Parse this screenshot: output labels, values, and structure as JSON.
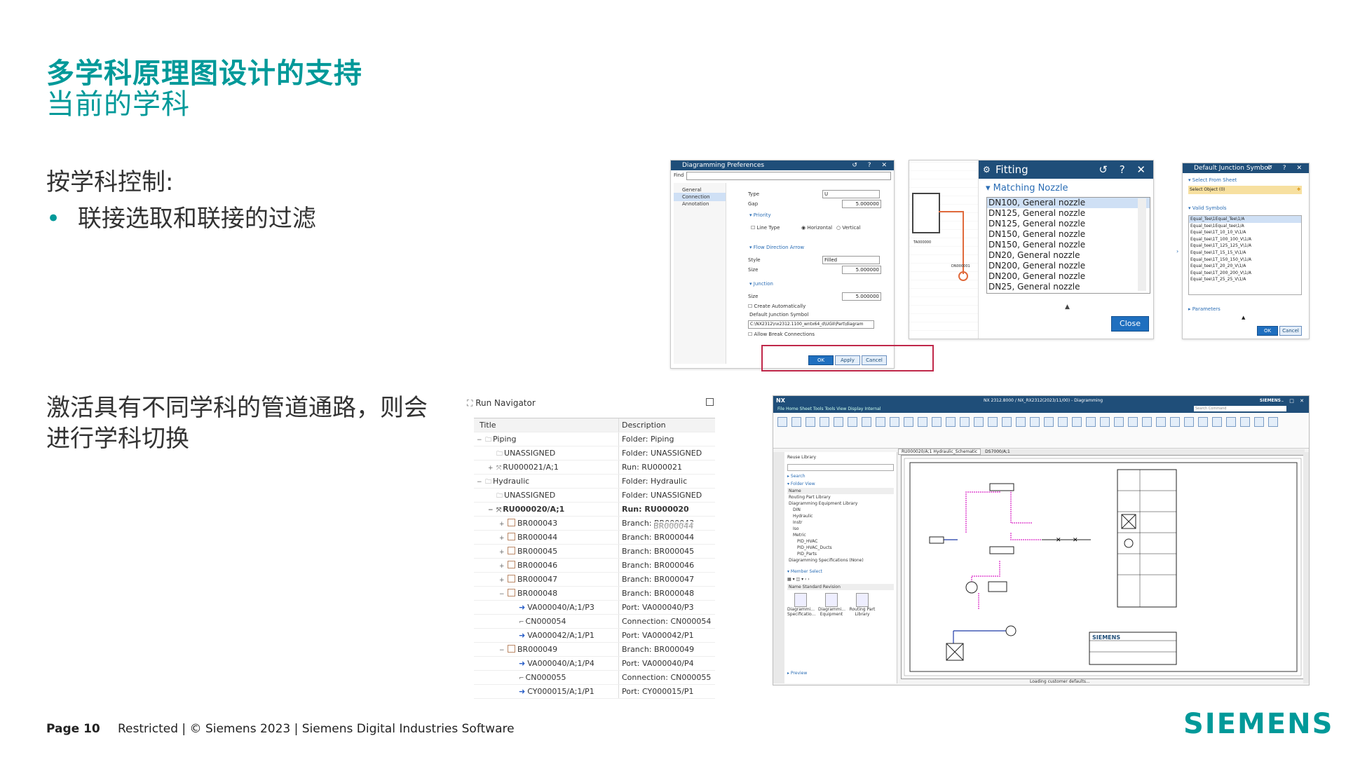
{
  "slide": {
    "title": "多学科原理图设计的支持",
    "subtitle": "当前的学科",
    "heading1": "按学科控制:",
    "bullet1": "联接选取和联接的过滤",
    "paragraph2_line1": "激活具有不同学科的管道通路，则会",
    "paragraph2_line2": "进行学科切换",
    "footer_page": "Page 10",
    "footer_text": "Restricted | © Siemens 2023 | Siemens Digital Industries Software",
    "logo": "SIEMENS",
    "accent_color": "#009999",
    "highlight_color": "#c0284a"
  },
  "prefs_dialog": {
    "title": "Diagramming Preferences",
    "find_label": "Find",
    "left_items": [
      "General",
      "Connection",
      "Annotation"
    ],
    "type_label": "Type",
    "type_value": "U",
    "gap_label": "Gap",
    "gap_value": "5.000000",
    "priority_section": "Priority",
    "line_type": "Line Type",
    "horizontal": "Horizontal",
    "vertical": "Vertical",
    "flow_section": "Flow Direction Arrow",
    "style_label": "Style",
    "style_value": "Filled",
    "size_label": "Size",
    "size_value": "5.000000",
    "junction_section": "Junction",
    "junction_size_label": "Size",
    "junction_size_value": "5.000000",
    "create_auto": "Create Automatically",
    "default_junction": "Default Junction Symbol",
    "junction_path": "C:\\NX2312\\nx2312.1100_wntx64_d\\UGII\\Part\\diagram",
    "allow_break": "Allow Break Connections",
    "ok": "OK",
    "apply": "Apply",
    "cancel": "Cancel"
  },
  "fitting_dialog": {
    "title": "Fitting",
    "section": "Matching Nozzle",
    "items": [
      "DN100, General nozzle",
      "DN125, General nozzle",
      "DN125, General nozzle",
      "DN150, General nozzle",
      "DN150, General nozzle",
      "DN20, General nozzle",
      "DN200, General nozzle",
      "DN200, General nozzle",
      "DN25, General nozzle"
    ],
    "close": "Close",
    "tag1": "TA000000",
    "tag2": "DN000001"
  },
  "junction_dialog": {
    "title": "Default Junction Symbol",
    "select_section": "Select From Sheet",
    "select_object": "Select Object (0)",
    "valid_section": "Valid Symbols",
    "symbols": [
      "Equal_Tee\\1Equal_Tee\\1/A",
      "Equal_tee\\1Equal_tee\\1/A",
      "Equal_tee\\1T_10_10_V\\1/A",
      "Equal_tee\\1T_100_100_V\\1/A",
      "Equal_tee\\1T_125_125_V\\1/A",
      "Equal_tee\\1T_15_15_V\\1/A",
      "Equal_tee\\1T_150_150_V\\1/A",
      "Equal_tee\\1T_20_20_V\\1/A",
      "Equal_tee\\1T_200_200_V\\1/A",
      "Equal_tee\\1T_25_25_V\\1/A"
    ],
    "parameters": "Parameters",
    "ok": "OK",
    "cancel": "Cancel"
  },
  "run_navigator": {
    "title": "Run Navigator",
    "col_title": "Title",
    "col_desc": "Description",
    "rows": [
      {
        "title": "Piping",
        "desc": "Folder: Piping",
        "indent": 0,
        "icon": "folder",
        "toggle": "-"
      },
      {
        "title": "UNASSIGNED",
        "desc": "Folder: UNASSIGNED",
        "indent": 1,
        "icon": "folder",
        "toggle": ""
      },
      {
        "title": "RU000021/A;1",
        "desc": "Run: RU000021",
        "indent": 1,
        "icon": "run",
        "toggle": "+"
      },
      {
        "title": "Hydraulic",
        "desc": "Folder: Hydraulic",
        "indent": 0,
        "icon": "folder",
        "toggle": "-"
      },
      {
        "title": "UNASSIGNED",
        "desc": "Folder: UNASSIGNED",
        "indent": 1,
        "icon": "folder",
        "toggle": ""
      },
      {
        "title": "RU000020/A;1",
        "desc": "Run: RU000020",
        "indent": 1,
        "icon": "run",
        "toggle": "-",
        "bold": true
      },
      {
        "title": "BR000043",
        "desc": "Branch: BR000043",
        "indent": 2,
        "icon": "branch",
        "toggle": "+"
      },
      {
        "title": "BR000044",
        "desc": "Branch: BR000044",
        "indent": 2,
        "icon": "branch",
        "toggle": "+"
      },
      {
        "title": "BR000045",
        "desc": "Branch: BR000045",
        "indent": 2,
        "icon": "branch",
        "toggle": "+"
      },
      {
        "title": "BR000046",
        "desc": "Branch: BR000046",
        "indent": 2,
        "icon": "branch",
        "toggle": "+"
      },
      {
        "title": "BR000047",
        "desc": "Branch: BR000047",
        "indent": 2,
        "icon": "branch",
        "toggle": "+"
      },
      {
        "title": "BR000048",
        "desc": "Branch: BR000048",
        "indent": 2,
        "icon": "branch",
        "toggle": "-"
      },
      {
        "title": "VA000040/A;1/P3",
        "desc": "Port: VA000040/P3",
        "indent": 3,
        "icon": "port",
        "toggle": ""
      },
      {
        "title": "CN000054",
        "desc": "Connection: CN000054",
        "indent": 3,
        "icon": "conn",
        "toggle": ""
      },
      {
        "title": "VA000042/A;1/P1",
        "desc": "Port: VA000042/P1",
        "indent": 3,
        "icon": "port",
        "toggle": ""
      },
      {
        "title": "BR000049",
        "desc": "Branch: BR000049",
        "indent": 2,
        "icon": "branch",
        "toggle": "-"
      },
      {
        "title": "VA000040/A;1/P4",
        "desc": "Port: VA000040/P4",
        "indent": 3,
        "icon": "port",
        "toggle": ""
      },
      {
        "title": "CN000055",
        "desc": "Connection: CN000055",
        "indent": 3,
        "icon": "conn",
        "toggle": ""
      },
      {
        "title": "CY000015/A;1/P1",
        "desc": "Port: CY000015/P1",
        "indent": 3,
        "icon": "port",
        "toggle": ""
      }
    ],
    "tooltip": "BR000044"
  },
  "nx_app": {
    "title": "NX 2312.8000 / NX_RX2312(2023/11/00) - Diagramming",
    "brand": "SIEMENS",
    "app_label": "NX",
    "menu": "File  Home  Sheet Tools  Tools  View  Display  Internal",
    "search_placeholder": "Search Command",
    "tab": "RU000020/A;1 Hydraulic_Schematic",
    "tab2": "DS7000/A;1",
    "panel_title": "Reuse Library",
    "search": "Search",
    "folder_view": "Folder View",
    "name_col": "Name",
    "tree": [
      "Routing Part Library",
      "Diagramming Equipment Library",
      "DIN",
      "Hydraulic",
      "Instr",
      "Iso",
      "Metric",
      "PID_HVAC",
      "PID_HVAC_Ducts",
      "PID_Parts",
      "Diagramming Specifications (None)"
    ],
    "member_select": "Member Select",
    "cols": "Name  Standard  Revision",
    "members": [
      "Diagrammi... Specificatio...",
      "Diagrammi... Equipment",
      "Routing Part Library"
    ],
    "preview": "Preview",
    "status": "Loading customer defaults...",
    "title_block_logo": "SIEMENS"
  }
}
